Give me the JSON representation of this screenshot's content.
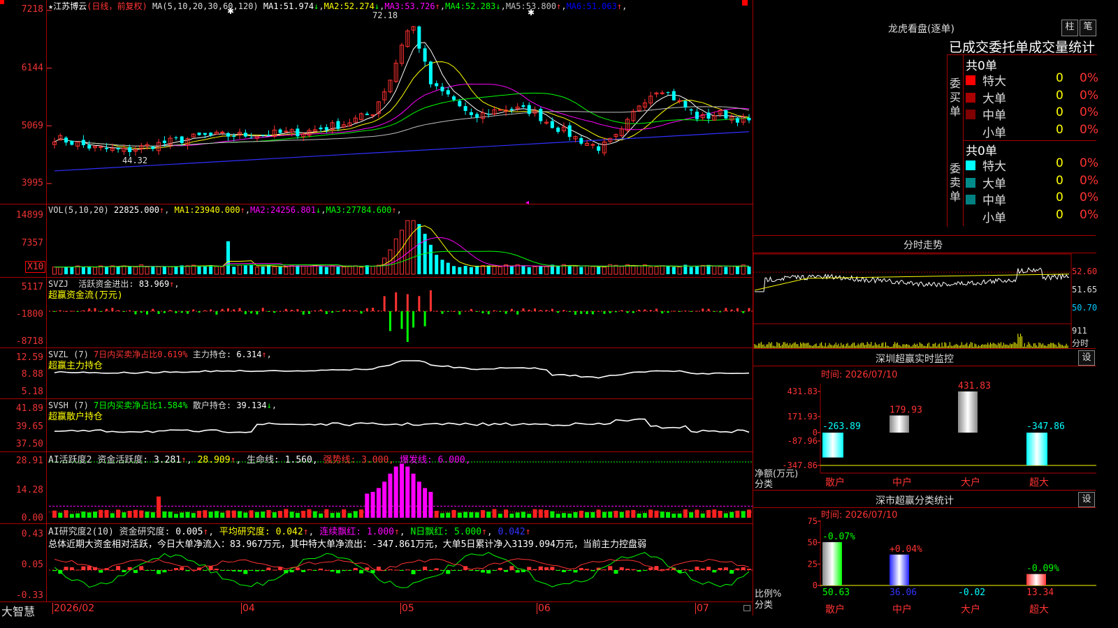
{
  "stock": {
    "star": "★",
    "name": "江苏博云",
    "mode": "(日线，前复权)"
  },
  "price": {
    "ma_header": "MA(5,10,20,30,60,120)",
    "ma": [
      {
        "label": "MA1:",
        "value": "51.974",
        "arrow": "↓",
        "color": "#ffffff"
      },
      {
        "label": "MA2:",
        "value": "52.274",
        "arrow": "↓",
        "color": "#ffff00"
      },
      {
        "label": "MA3:",
        "value": "53.726",
        "arrow": "↑",
        "color": "#ff00ff"
      },
      {
        "label": "MA4:",
        "value": "52.283",
        "arrow": "↓",
        "color": "#00ff00"
      },
      {
        "label": "MA5:",
        "value": "53.800",
        "arrow": "↑",
        "color": "#c0c0c0"
      },
      {
        "label": "MA6:",
        "value": "51.063",
        "arrow": "↑",
        "color": "#0000ff"
      }
    ],
    "y_labels": [
      "7218",
      "6144",
      "5069",
      "3995"
    ],
    "high_note": "72.18",
    "low_note": "44.32"
  },
  "vol": {
    "header": "VOL(5,10,20)",
    "value": "22825.000",
    "arrow": "↑",
    "ma": [
      {
        "label": "MA1:",
        "value": "23940.000",
        "arrow": "↑",
        "color": "#ffff00"
      },
      {
        "label": "MA2:",
        "value": "24256.801",
        "arrow": "↓",
        "color": "#ff00ff"
      },
      {
        "label": "MA3:",
        "value": "27784.600",
        "arrow": "↑",
        "color": "#00ff00"
      }
    ],
    "y_labels": [
      "14899",
      "7357"
    ],
    "unit": "X10"
  },
  "svzj": {
    "header": "SVZJ",
    "text": "活跃资金进出:",
    "value": "83.969",
    "arrow": "↑",
    "comma": ",",
    "sub": "超赢资金流(万元)",
    "y_labels": [
      "5117",
      "-1800",
      "-8718"
    ]
  },
  "svzl": {
    "header": "SVZL (7)",
    "red_text": "7日内买卖净占比0.619%",
    "text": "主力持仓:",
    "value": "6.314",
    "arrow": "↑",
    "comma": ",",
    "sub": "超赢主力持仓",
    "y_labels": [
      "12.59",
      "8.88",
      "5.18"
    ]
  },
  "svsh": {
    "header": "SVSH (7)",
    "green_text": "7日内买卖净占比1.584%",
    "text": "散户持仓:",
    "value": "39.134",
    "arrow": "↓",
    "comma": ",",
    "sub": "超赢散户持仓",
    "y_labels": [
      "41.89",
      "39.65",
      "37.50"
    ]
  },
  "ai1": {
    "header": "AI活跃度2",
    "text": "资金活跃度:",
    "value": "3.281",
    "arrow": "↑",
    "v2": "28.909",
    "arrow2": "↑",
    "life": "生命线:",
    "life_v": "1.560,",
    "strong": "强势线:",
    "strong_v": "3.000,",
    "burst": "爆发线:",
    "burst_v": "6.000,",
    "y_labels": [
      "28.91",
      "14.28",
      "0.00"
    ]
  },
  "ai2": {
    "header": "AI研究度2(10)",
    "text": "资金研究度:",
    "value": "0.005",
    "arrow": "↑",
    "avg": "平均研究度:",
    "avg_v": "0.042",
    "c_red": "连续飘红:",
    "c_red_v": "1.000",
    "n_red": "N日飘红:",
    "n_red_v": "5.000",
    "last": "0.042",
    "summary": "总体近期大资金相对活跃，今日大单净流入：83.967万元，其中特大单净流出：-347.861万元，大单5日累计净入3139.094万元，当前主力控盘弱",
    "y_labels": [
      "0.43",
      "0.05",
      "-0.33"
    ]
  },
  "dates": {
    "app": "大智慧",
    "labels": [
      "2026/02",
      "04",
      "05",
      "06",
      "07"
    ]
  },
  "sidebar": {
    "title": "龙虎看盘(逐单)",
    "btn1": "柱",
    "btn2": "笔",
    "table_title": "已成交委托单成交量统计",
    "buy": {
      "side": "委买单",
      "total": "共0单",
      "rows": [
        {
          "name": "特大",
          "count": "0",
          "pct": "0%",
          "color": "#ff0000"
        },
        {
          "name": "大单",
          "count": "0",
          "pct": "0%",
          "color": "#aa0000"
        },
        {
          "name": "中单",
          "count": "0",
          "pct": "0%",
          "color": "#800000"
        },
        {
          "name": "小单",
          "count": "0",
          "pct": "0%",
          "color": "#000000"
        }
      ]
    },
    "sell": {
      "side": "委卖单",
      "total": "共0单",
      "rows": [
        {
          "name": "特大",
          "count": "0",
          "pct": "0%",
          "color": "#00ffff"
        },
        {
          "name": "大单",
          "count": "0",
          "pct": "0%",
          "color": "#008b8b"
        },
        {
          "name": "中单",
          "count": "0",
          "pct": "0%",
          "color": "#008080"
        },
        {
          "name": "小单",
          "count": "0",
          "pct": "0%",
          "color": "#000000"
        }
      ]
    },
    "fenshi": {
      "title": "分时走势",
      "y_labels": [
        "52.60",
        "51.65",
        "50.70"
      ],
      "vol_label": "911",
      "vol_unit": "分时"
    },
    "monitor": {
      "title": "深圳超赢实时监控",
      "btn": "设",
      "time": "时间: 2026/07/10",
      "y_labels": [
        "431.83",
        "171.93",
        "0",
        "-87.96",
        "-347.86"
      ],
      "y_unit": "净额(万元)",
      "x_unit": "分类",
      "bars": [
        {
          "cat": "散户",
          "value": -263.89,
          "label": "-263.89"
        },
        {
          "cat": "中户",
          "value": 179.93,
          "label": "179.93"
        },
        {
          "cat": "大户",
          "value": 431.83,
          "label": "431.83"
        },
        {
          "cat": "超大",
          "value": -347.86,
          "label": "-347.86"
        }
      ]
    },
    "classify": {
      "title": "深市超赢分类统计",
      "btn": "设",
      "time": "时间: 2026/07/10",
      "y_labels": [
        "75",
        "50",
        "25",
        "0"
      ],
      "y_unit": "比例%",
      "x_unit": "分类",
      "bars": [
        {
          "cat": "散户",
          "value": 50.63,
          "label": "50.63",
          "change": "-0.07%"
        },
        {
          "cat": "中户",
          "value": 36.06,
          "label": "36.06",
          "change": "+0.04%"
        },
        {
          "cat": "大户",
          "value": -0.02,
          "label": "-0.02",
          "change": ""
        },
        {
          "cat": "超大",
          "value": 13.34,
          "label": "13.34",
          "change": "-0.09%"
        }
      ]
    }
  }
}
